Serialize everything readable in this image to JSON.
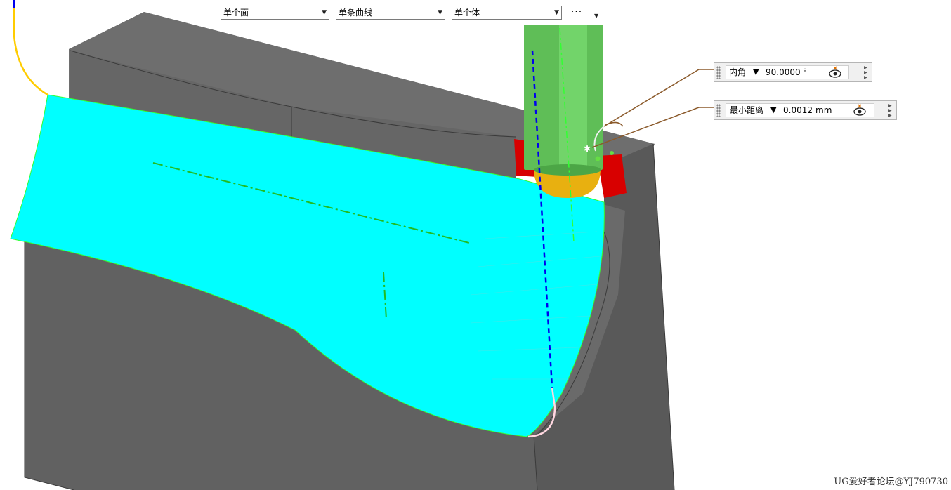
{
  "selection_bar": {
    "face_filter": "单个面",
    "curve_filter": "单条曲线",
    "body_filter": "单个体",
    "more_label": "···"
  },
  "hud_angle": {
    "label": "内角",
    "caret": "▼",
    "value": "90.0000",
    "unit": "°"
  },
  "hud_distance": {
    "label": "最小距离",
    "caret": "▼",
    "value": "0.0012",
    "unit": "mm"
  },
  "watermark": "UG爱好者论坛@YJ790730",
  "colors": {
    "surface": "#00ffff",
    "tool_shank": "#5fbe57",
    "tool_ball": "#e8b010",
    "gouge": "#d80000",
    "block_top": "#7a7a7a",
    "block_side": "#5f5f5f",
    "tool_axis": "#0000ee",
    "leader": "#8b5a2b"
  }
}
